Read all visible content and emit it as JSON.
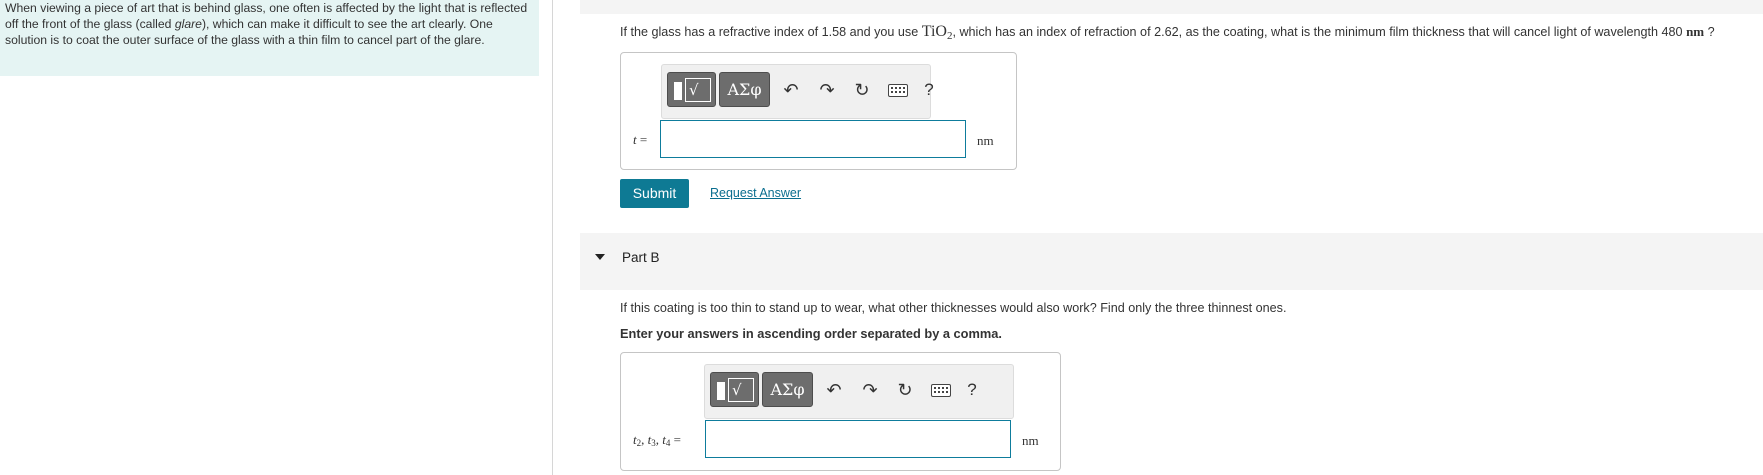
{
  "intro": {
    "text_1": "When viewing a piece of art that is behind glass, one often is affected by the light that is reflected off the front of the glass (called ",
    "text_em": "glare",
    "text_2": "), which can make it difficult to see the art clearly. One solution is to coat the outer surface of the glass with a thin film to cancel part of the glare."
  },
  "part_a": {
    "q_1": "If the glass has a refractive index of 1.58 and you use ",
    "q_compound": "TiO",
    "q_subscript": "2",
    "q_2": ", which has an index of refraction of 2.62, as the coating, what is the minimum film thickness that will cancel light of wavelength 480 ",
    "q_unit": "nm",
    "q_3": " ?",
    "var_t": "t",
    "equals": " =",
    "unit": "nm",
    "input_value": ""
  },
  "toolbar": {
    "template_glyph": "√",
    "symbols_label": "ΑΣφ",
    "undo_icon": "↶",
    "redo_icon": "↷",
    "reset_icon": "↻",
    "help_label": "?"
  },
  "actions": {
    "submit_label": "Submit",
    "request_answer_label": "Request Answer"
  },
  "part_b": {
    "title": "Part B",
    "question": "If this coating is too thin to stand up to wear, what other thicknesses would also work? Find only the three thinnest ones.",
    "instruction": "Enter your answers in ascending order separated by a comma.",
    "var_t": "t",
    "sub_2": "2",
    "sub_3": "3",
    "sub_4": "4",
    "sep": ", ",
    "equals": " =",
    "unit": "nm",
    "input_value": ""
  },
  "colors": {
    "intro_bg": "#e5f4f3",
    "accent": "#0e7a94",
    "link": "#0a6e8f",
    "section_bg": "#f4f4f4"
  }
}
